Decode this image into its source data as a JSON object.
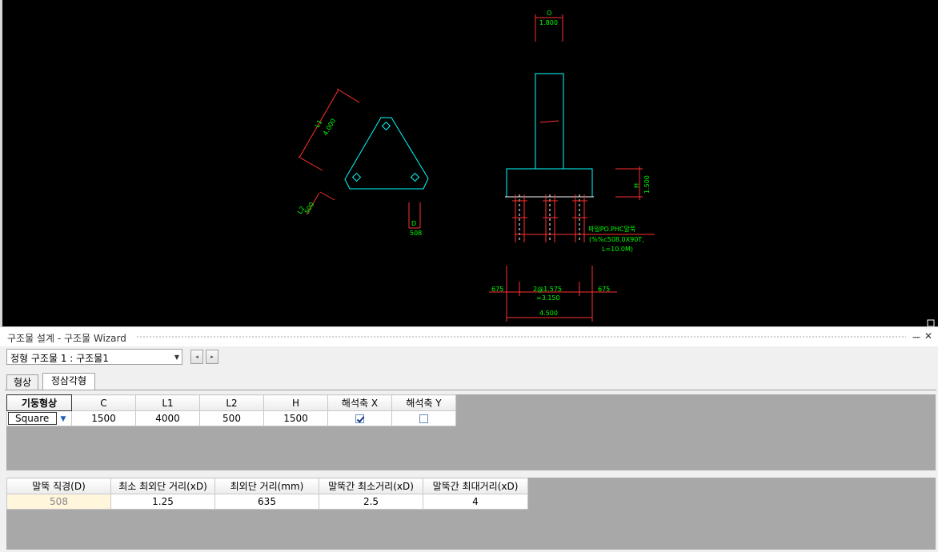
{
  "drawing": {
    "top_label_o": "O",
    "top_dim": "1.800",
    "l1_label": "L1",
    "l1_value": "4.000",
    "l2_label": "L2",
    "l2_value": "500",
    "d_label": "D",
    "d_value": "508",
    "h_label": "H",
    "h_value": "1.500",
    "pile_note_1": "파일PO.PHC말뚝",
    "pile_note_2": "(%%c508.0X90T,",
    "pile_note_3": "L=10.0M)",
    "dim_left": "675",
    "dim_mid_1": "2@1.575",
    "dim_mid_2": "=3.150",
    "dim_right": "675",
    "dim_total": "4.500"
  },
  "panel": {
    "title": "구조물 설계 - 구조물 Wizard",
    "pin_icon": "pin-icon",
    "close_icon": "close-icon",
    "pin_glyph": "ᅲ",
    "close_glyph": "✕",
    "structure_select": "정형 구조물 1 : 구조물1",
    "prev_glyph": "◂",
    "next_glyph": "▸",
    "tabs": [
      {
        "label": "형상",
        "active": false
      },
      {
        "label": "정삼각형",
        "active": true
      }
    ]
  },
  "table1": {
    "headers": [
      "기둥형상",
      "C",
      "L1",
      "L2",
      "H",
      "해석축 X",
      "해석축 Y"
    ],
    "row": {
      "shape": "Square",
      "c": "1500",
      "l1": "4000",
      "l2": "500",
      "h": "1500",
      "axis_x": true,
      "axis_y": false
    }
  },
  "table2": {
    "headers": [
      "말뚝 직경(D)",
      "최소 최외단 거리(xD)",
      "최외단 거리(mm)",
      "말뚝간 최소거리(xD)",
      "말뚝간 최대거리(xD)"
    ],
    "row": [
      "508",
      "1.25",
      "635",
      "2.5",
      "4"
    ]
  }
}
